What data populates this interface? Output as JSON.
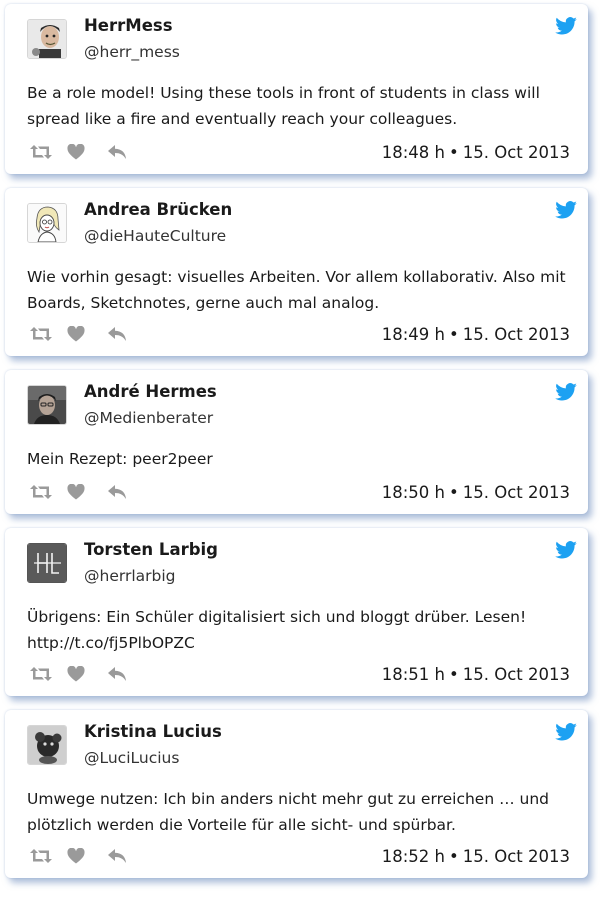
{
  "colors": {
    "twitter_blue": "#1da1f2",
    "action_gray": "#9a9a9a"
  },
  "icons": {
    "brand": "twitter-bird-icon",
    "retweet": "retweet-icon",
    "like": "heart-icon",
    "reply": "reply-icon"
  },
  "tweets": [
    {
      "name": "HerrMess",
      "handle": "@herr_mess",
      "text": "Be a role model! Using these tools in front of students in class will spread like a fire and eventually reach your colleagues.",
      "time": "18:48 h",
      "separator": "•",
      "date": "15. Oct 2013",
      "avatar": "cartoon-man-avatar"
    },
    {
      "name": "Andrea Brücken",
      "handle": "@dieHauteCulture",
      "text": "Wie vorhin gesagt: visuelles Arbeiten. Vor allem kollaborativ. Also mit Boards, Sketchnotes, gerne auch mal analog.",
      "time": "18:49 h",
      "separator": "•",
      "date": "15. Oct 2013",
      "avatar": "sketch-woman-avatar"
    },
    {
      "name": "André Hermes",
      "handle": "@Medienberater",
      "text": "Mein Rezept: peer2peer",
      "time": "18:50 h",
      "separator": "•",
      "date": "15. Oct 2013",
      "avatar": "photo-man-avatar"
    },
    {
      "name": "Torsten Larbig",
      "handle": "@herrlarbig",
      "text": "Übrigens: Ein Schüler digitalisiert sich und bloggt drüber. Lesen! http://t.co/fj5PlbOPZC",
      "time": "18:51 h",
      "separator": "•",
      "date": "15. Oct 2013",
      "avatar": "monogram-avatar"
    },
    {
      "name": "Kristina Lucius",
      "handle": "@LuciLucius",
      "text": "Umwege nutzen: Ich bin anders nicht mehr gut zu erreichen … und plötzlich werden die Vorteile für alle sicht- und spürbar.",
      "time": "18:52 h",
      "separator": "•",
      "date": "15. Oct 2013",
      "avatar": "toy-figure-avatar"
    }
  ]
}
